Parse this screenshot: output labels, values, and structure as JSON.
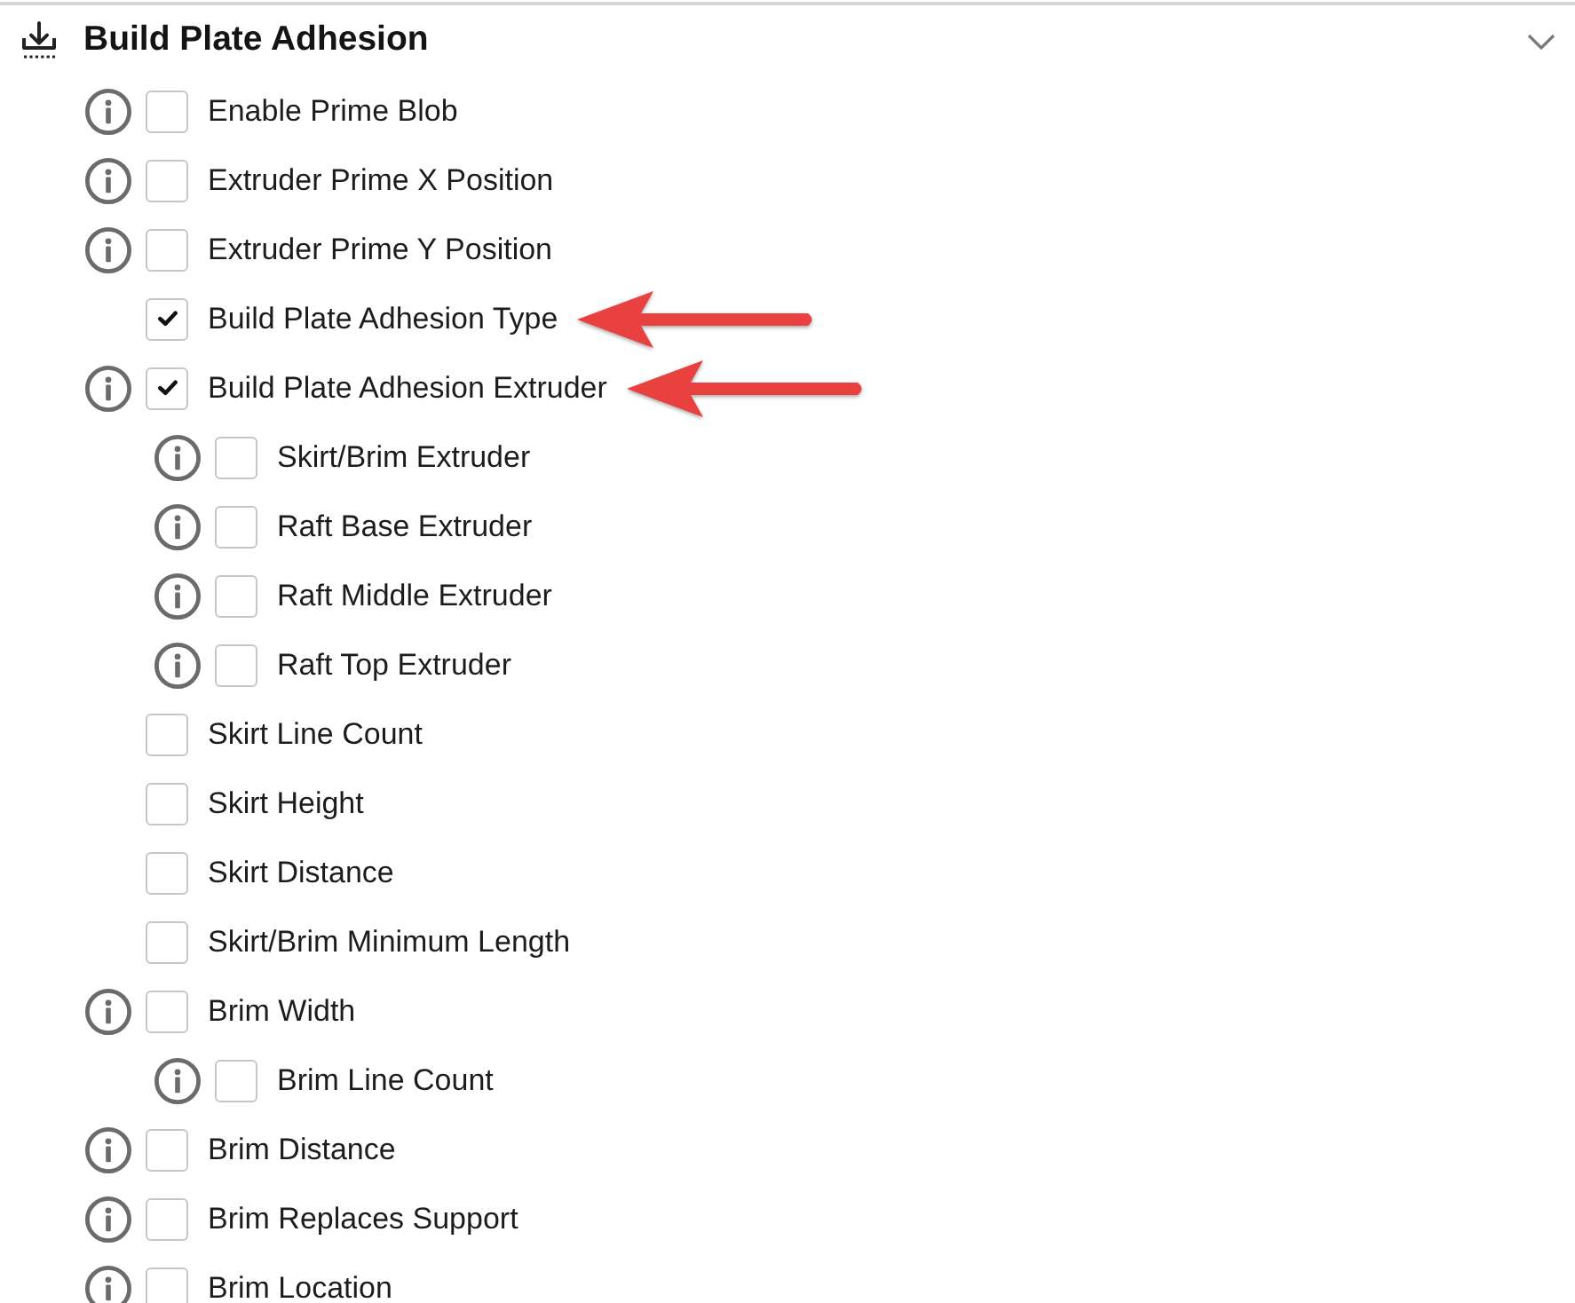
{
  "section": {
    "title": "Build Plate Adhesion",
    "expanded": true
  },
  "settings": [
    {
      "label": "Enable Prime Blob",
      "checked": false,
      "info": true,
      "arrow": false
    },
    {
      "label": "Extruder Prime X Position",
      "checked": false,
      "info": true,
      "arrow": false
    },
    {
      "label": "Extruder Prime Y Position",
      "checked": false,
      "info": true,
      "arrow": false
    },
    {
      "label": "Build Plate Adhesion Type",
      "checked": true,
      "info": false,
      "arrow": true
    },
    {
      "label": "Build Plate Adhesion Extruder",
      "checked": true,
      "info": true,
      "arrow": true,
      "children": [
        {
          "label": "Skirt/Brim Extruder",
          "checked": false,
          "info": true,
          "arrow": false
        },
        {
          "label": "Raft Base Extruder",
          "checked": false,
          "info": true,
          "arrow": false
        },
        {
          "label": "Raft Middle Extruder",
          "checked": false,
          "info": true,
          "arrow": false
        },
        {
          "label": "Raft Top Extruder",
          "checked": false,
          "info": true,
          "arrow": false
        }
      ]
    },
    {
      "label": "Skirt Line Count",
      "checked": false,
      "info": false,
      "arrow": false
    },
    {
      "label": "Skirt Height",
      "checked": false,
      "info": false,
      "arrow": false
    },
    {
      "label": "Skirt Distance",
      "checked": false,
      "info": false,
      "arrow": false
    },
    {
      "label": "Skirt/Brim Minimum Length",
      "checked": false,
      "info": false,
      "arrow": false
    },
    {
      "label": "Brim Width",
      "checked": false,
      "info": true,
      "arrow": false,
      "children": [
        {
          "label": "Brim Line Count",
          "checked": false,
          "info": true,
          "arrow": false
        }
      ]
    },
    {
      "label": "Brim Distance",
      "checked": false,
      "info": true,
      "arrow": false
    },
    {
      "label": "Brim Replaces Support",
      "checked": false,
      "info": true,
      "arrow": false
    },
    {
      "label": "Brim Location",
      "checked": false,
      "info": true,
      "arrow": false
    }
  ]
}
